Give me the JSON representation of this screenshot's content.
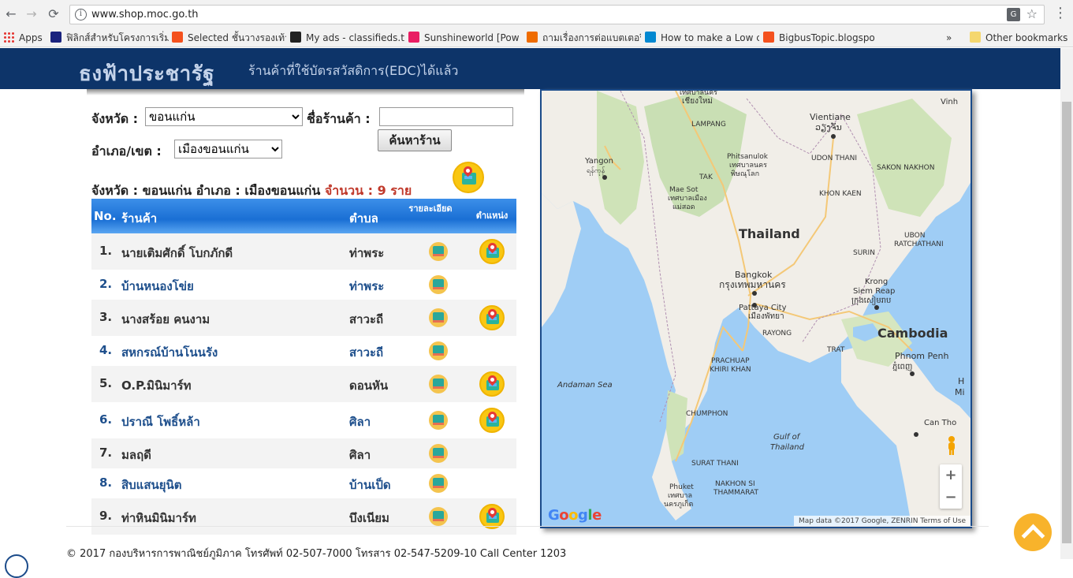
{
  "browser": {
    "url": "www.shop.moc.go.th",
    "bookmarks": [
      {
        "label": "Apps",
        "color": "#e53935"
      },
      {
        "label": "ฟิลิกส์สำหรับโครงการเริ่ม",
        "color": "#1a237e"
      },
      {
        "label": "Selected ชั้นวางรองเท้า",
        "color": "#f4511e"
      },
      {
        "label": "My ads - classifieds.th",
        "color": "#222222"
      },
      {
        "label": "Sunshineworld [Pow",
        "color": "#e91e63"
      },
      {
        "label": "ถามเรื่องการต่อแบตเตอรี่",
        "color": "#ef6c00"
      },
      {
        "label": "How to make a Low c",
        "color": "#0288d1"
      },
      {
        "label": "BigbusTopic.blogspo",
        "color": "#f4511e"
      }
    ],
    "more_label": "»",
    "other_bookmarks": "Other bookmarks"
  },
  "header": {
    "title": "ธงฟ้าประชารัฐ",
    "subtitle": "ร้านค้าที่ใช้บัตรสวัสดิการ(EDC)ได้แล้ว"
  },
  "form": {
    "province_label": "จังหวัด :",
    "province_value": "ขอนแก่น",
    "district_label": "อำเภอ/เขต :",
    "district_value": "เมืองขอนแก่น",
    "shopname_label": "ชื่อร้านค้า :",
    "shopname_value": "",
    "search_label": "ค้นหาร้าน"
  },
  "summary": {
    "text": "จังหวัด : ขอนแก่น  อำเภอ : เมืองขอนแก่น",
    "count_text": "จำนวน : 9 ราย"
  },
  "table": {
    "headers": {
      "no": "No.",
      "shop": "ร้านค้า",
      "subdistrict": "ตำบล",
      "detail": "รายละเอียด",
      "location": "ตำแหน่ง"
    },
    "rows": [
      {
        "no": "1.",
        "shop": "นายเติมศักดิ์ โบกภักดี",
        "subdistrict": "ท่าพระ",
        "has_location": true
      },
      {
        "no": "2.",
        "shop": "บ้านหนองโข่ย",
        "subdistrict": "ท่าพระ",
        "has_location": false
      },
      {
        "no": "3.",
        "shop": "นางสร้อย คนงาม",
        "subdistrict": "สาวะถี",
        "has_location": true
      },
      {
        "no": "4.",
        "shop": "สหกรณ์บ้านโนนรัง",
        "subdistrict": "สาวะถี",
        "has_location": false
      },
      {
        "no": "5.",
        "shop": "O.P.มินิมาร์ท",
        "subdistrict": "ดอนหัน",
        "has_location": true
      },
      {
        "no": "6.",
        "shop": "ปราณี โพธิ์หล้า",
        "subdistrict": "ศิลา",
        "has_location": true
      },
      {
        "no": "7.",
        "shop": "มลฤดี",
        "subdistrict": "ศิลา",
        "has_location": false
      },
      {
        "no": "8.",
        "shop": "สิบแสนยุนิต",
        "subdistrict": "บ้านเป็ด",
        "has_location": false
      },
      {
        "no": "9.",
        "shop": "ท่าหินมินิมาร์ท",
        "subdistrict": "บึงเนียม",
        "has_location": true
      }
    ]
  },
  "map": {
    "labels": {
      "thailand": "Thailand",
      "cambodia": "Cambodia",
      "bangkok": "Bangkok",
      "bangkok_th": "กรุงเทพมหานคร",
      "vientiane": "Vientiane",
      "vientiane_lo": "ວຽງຈັນ",
      "yangon": "Yangon",
      "yangon_my": "ရန်ကုန်",
      "phnom_penh": "Phnom Penh",
      "phnom_penh_km": "ភ្នំពេញ",
      "pattaya": "Pattaya City",
      "pattaya_th": "เมืองพัทยา",
      "krong_siem_reap": "Krong",
      "siem_reap": "Siem Reap",
      "siem_reap_km": "ក្រុងសៀមរាប",
      "phitsanulok": "Phitsanulok",
      "phitsanulok_th": "เทศบาลนคร",
      "phitsanulok_th2": "พิษณุโลก",
      "mae_sot": "Mae Sot",
      "mae_sot_th": "เทศบาลเมือง",
      "mae_sot_th2": "แม่สอด",
      "chiang_mai_th": "เชียงใหม่",
      "chiang_mai_th_top": "เทศบาลนคร",
      "phuket": "Phuket",
      "phuket_th": "เทศบาล",
      "phuket_th2": "นครภูเก็ต",
      "can_tho": "Can Tho",
      "vinh": "Vinh",
      "lampang": "LAMPANG",
      "tak": "TAK",
      "udon_thani": "UDON THANI",
      "sakon_nakhon": "SAKON NAKHON",
      "khon_kaen": "KHON KAEN",
      "ubon": "UBON",
      "ratchathani": "RATCHATHANI",
      "surin": "SURIN",
      "rayong": "RAYONG",
      "trat": "TRAT",
      "prachuap": "PRACHUAP",
      "khiri_khan": "KHIRI KHAN",
      "chumphon": "CHUMPHON",
      "surat_thani": "SURAT THANI",
      "nakhon_si": "NAKHON SI",
      "thammarat": "THAMMARAT",
      "andaman_sea": "Andaman Sea",
      "gulf_of": "Gulf of",
      "gulf_thailand": "Thailand",
      "mi": "Mi",
      "h": "H"
    },
    "logo": "Google",
    "footer": "Map data ©2017 Google, ZENRIN    Terms of Use",
    "zoom_in": "+",
    "zoom_out": "−"
  },
  "footer": {
    "copyright": "© 2017 กองบริหารการพาณิชย์ภูมิภาค โทรศัพท์ 02-507-7000 โทรสาร 02-547-5209-10 Call Center 1203"
  }
}
